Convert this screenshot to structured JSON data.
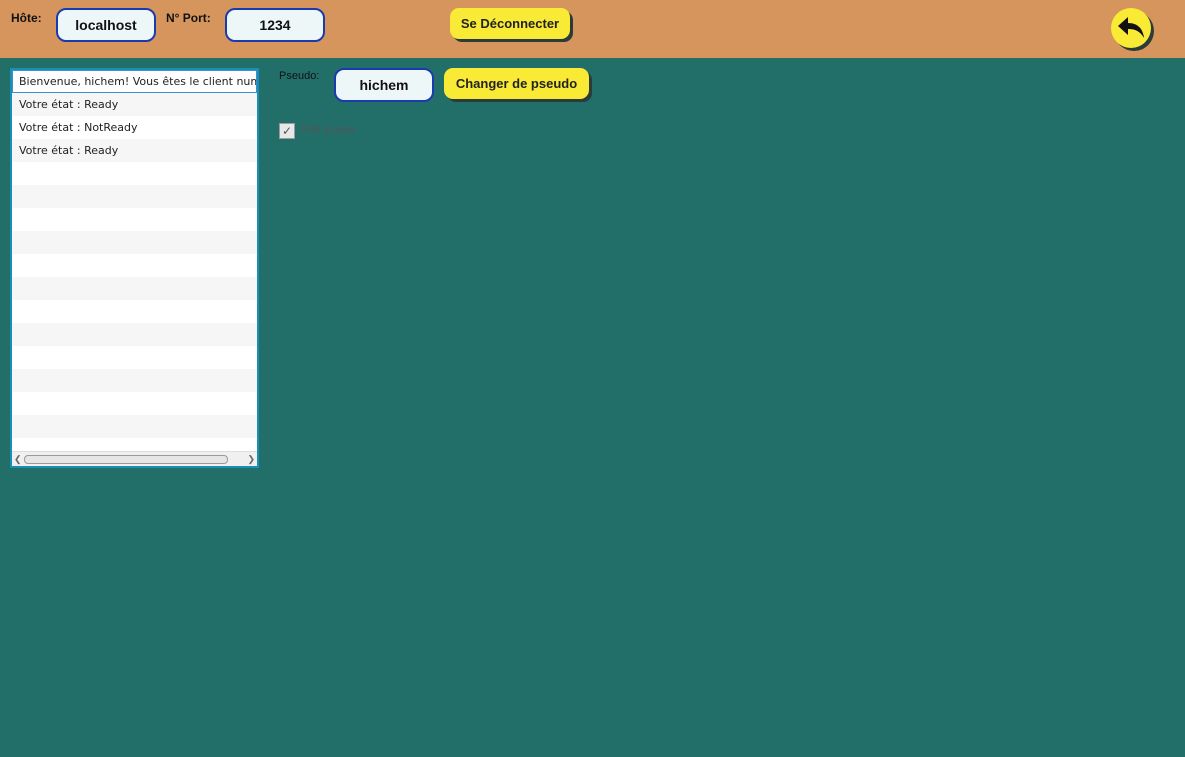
{
  "connection": {
    "host_label": "Hôte:",
    "host_value": "localhost",
    "port_label": "N° Port:",
    "port_value": "1234",
    "disconnect_label": "Se Déconnecter"
  },
  "back_button": {
    "icon": "back-arrow-icon"
  },
  "messages": [
    "Bienvenue, hichem! Vous êtes le client numéro",
    "Votre état : Ready",
    "Votre état : NotReady",
    "Votre état : Ready"
  ],
  "profile": {
    "pseudo_label": "Pseudo:",
    "pseudo_value": "hichem",
    "change_label": "Changer de pseudo",
    "ready_label": "Prêt à jouer",
    "ready_checked": true
  },
  "colors": {
    "topbar": "#d6955c",
    "background": "#226e69",
    "button": "#f8ea35",
    "field_border": "#1a3bb0"
  }
}
